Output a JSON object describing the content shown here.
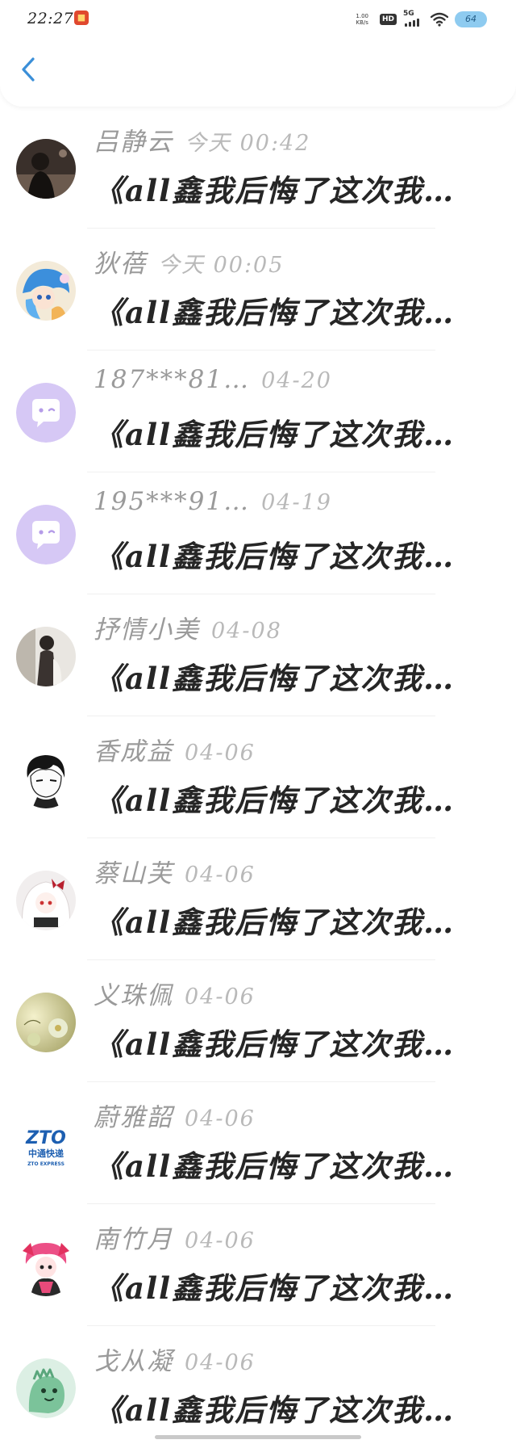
{
  "status_bar": {
    "time": "22:27",
    "net_speed_value": "1.00",
    "net_speed_unit": "KB/s",
    "hd": "HD",
    "network": "5G",
    "battery": "64"
  },
  "header": {
    "back_icon": "chevron-left-icon"
  },
  "colors": {
    "accent": "#3b8fd8",
    "name_text": "#9a9a9a",
    "time_text": "#b9b9b9",
    "message_text": "#262626",
    "default_avatar": "#d6c8f5"
  },
  "comments": [
    {
      "name": "吕静云",
      "time": "今天 00:42",
      "message": "《all鑫我后悔了这次我…",
      "avatar": "photo-dark"
    },
    {
      "name": "狄蓓",
      "time": "今天 00:05",
      "message": "《all鑫我后悔了这次我…",
      "avatar": "anime-blue"
    },
    {
      "name": "187***81…",
      "time": "04-20",
      "message": "《all鑫我后悔了这次我…",
      "avatar": "default-chat"
    },
    {
      "name": "195***91…",
      "time": "04-19",
      "message": "《all鑫我后悔了这次我…",
      "avatar": "default-chat"
    },
    {
      "name": "抒情小美",
      "time": "04-08",
      "message": "《all鑫我后悔了这次我…",
      "avatar": "photo-girl"
    },
    {
      "name": "香成益",
      "time": "04-06",
      "message": "《all鑫我后悔了这次我…",
      "avatar": "anime-boy"
    },
    {
      "name": "蔡山芙",
      "time": "04-06",
      "message": "《all鑫我后悔了这次我…",
      "avatar": "anime-white"
    },
    {
      "name": "义珠佩",
      "time": "04-06",
      "message": "《all鑫我后悔了这次我…",
      "avatar": "photo-flower"
    },
    {
      "name": "蔚雅韶",
      "time": "04-06",
      "message": "《all鑫我后悔了这次我…",
      "avatar": "zto-logo"
    },
    {
      "name": "南竹月",
      "time": "04-06",
      "message": "《all鑫我后悔了这次我…",
      "avatar": "anime-pink"
    },
    {
      "name": "戈从凝",
      "time": "04-06",
      "message": "《all鑫我后悔了这次我…",
      "avatar": "dino-green"
    }
  ],
  "zto_logo": {
    "mark": "ZTO",
    "cn": "中通快递",
    "en": "ZTO EXPRESS"
  }
}
